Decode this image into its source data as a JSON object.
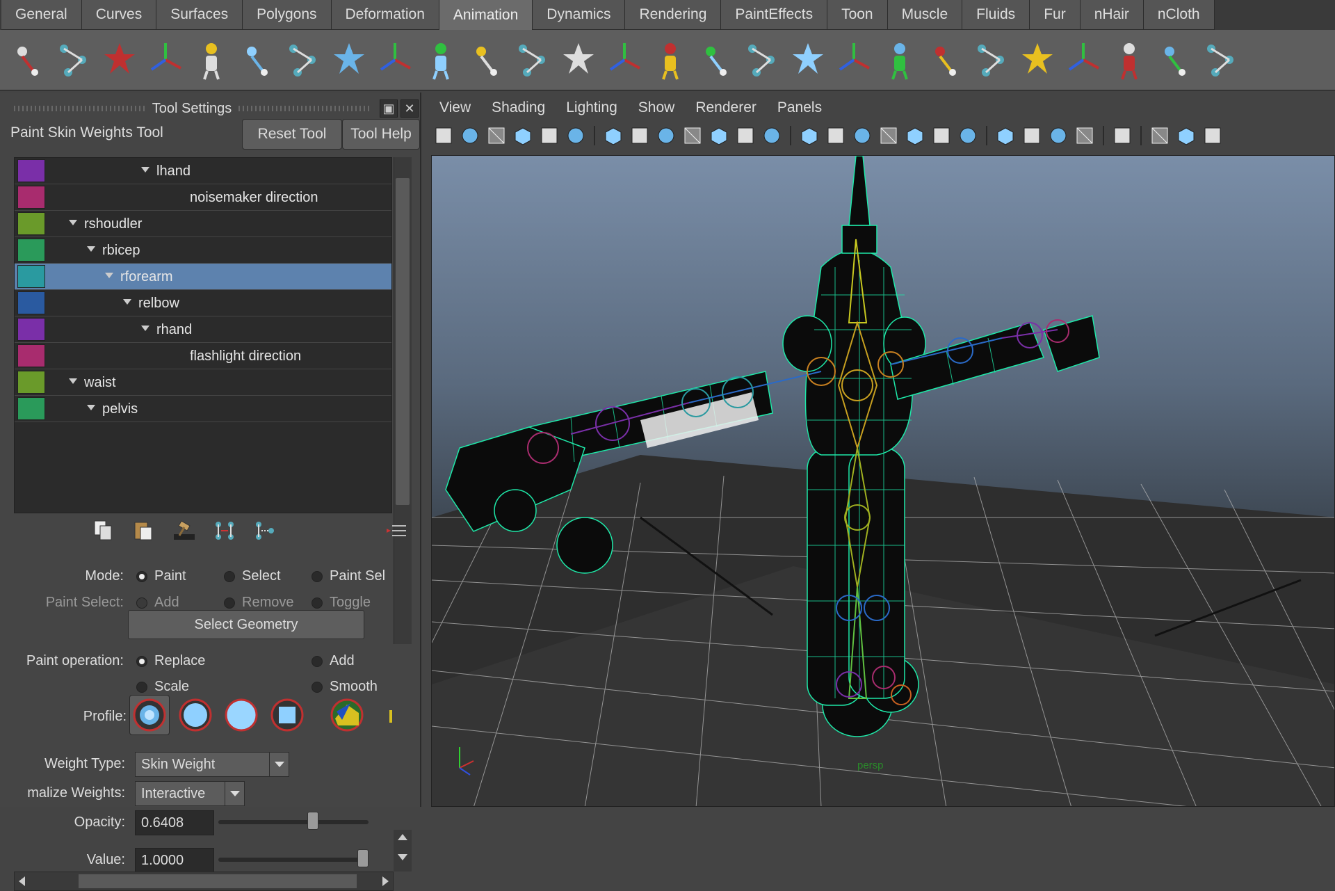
{
  "shelf": {
    "tabs": [
      "General",
      "Curves",
      "Surfaces",
      "Polygons",
      "Deformation",
      "Animation",
      "Dynamics",
      "Rendering",
      "PaintEffects",
      "Toon",
      "Muscle",
      "Fluids",
      "Fur",
      "nHair",
      "nCloth"
    ],
    "active_tab": "Animation",
    "icons": [
      "set-key-icon",
      "ik-handle-icon",
      "ik-spline-icon",
      "bind-skin-icon",
      "smooth-bind-icon",
      "character-icon",
      "joint-tool-icon",
      "insert-joint-icon",
      "mirror-joint-icon",
      "orient-joint-icon",
      "remove-joint-icon",
      "delete-history-icon",
      "connect-joint-icon",
      "disconnect-joint-icon",
      "joint-axis-icon",
      "joint-chain-icon",
      "skeleton-icon",
      "hair-head-icon",
      "hair-head-2-icon",
      "paint-weights-icon",
      "export-weights-icon",
      "paint-brush-icon",
      "cluster-icon",
      "point-constraint-icon",
      "aim-constraint-icon",
      "orient-constraint-icon",
      "parent-constraint-icon"
    ]
  },
  "tool_settings": {
    "title": "Tool Settings",
    "tool_name": "Paint Skin Weights Tool",
    "reset_label": "Reset Tool",
    "help_label": "Tool Help",
    "influences": [
      {
        "name": "lhand",
        "color": "#7a2fa8",
        "indent": 0,
        "expanded": true
      },
      {
        "name": "noisemaker direction",
        "color": "#a82c6e",
        "indent": 1,
        "expanded": false
      },
      {
        "name": "rshoudler",
        "color": "#6a9a2a",
        "indent": -4,
        "expanded": true
      },
      {
        "name": "rbicep",
        "color": "#2a9a5a",
        "indent": -3,
        "expanded": true
      },
      {
        "name": "rforearm",
        "color": "#2a9aa0",
        "indent": -2,
        "expanded": true,
        "selected": true
      },
      {
        "name": "relbow",
        "color": "#2a5aa0",
        "indent": -1,
        "expanded": true
      },
      {
        "name": "rhand",
        "color": "#7a2fa8",
        "indent": 0,
        "expanded": true
      },
      {
        "name": "flashlight direction",
        "color": "#a82c6e",
        "indent": 1,
        "expanded": false
      },
      {
        "name": "waist",
        "color": "#6a9a2a",
        "indent": -4,
        "expanded": true
      },
      {
        "name": "pelvis",
        "color": "#2a9a5a",
        "indent": -3,
        "expanded": true
      }
    ],
    "mode_label": "Mode:",
    "mode_options": [
      "Paint",
      "Select",
      "Paint Sel"
    ],
    "paint_select_label": "Paint Select:",
    "paint_select_options": [
      "Add",
      "Remove",
      "Toggle"
    ],
    "select_geometry_label": "Select Geometry",
    "paint_operation_label": "Paint operation:",
    "paint_operations": [
      "Replace",
      "Add",
      "Scale",
      "Smooth"
    ],
    "profile_label": "Profile:",
    "weight_type_label": "Weight Type:",
    "weight_type_value": "Skin Weight",
    "normalize_label": "malize Weights:",
    "normalize_value": "Interactive",
    "opacity_label": "Opacity:",
    "opacity_value": "0.6408",
    "opacity_fraction": 0.6408,
    "value_label": "Value:",
    "value_value": "1.0000",
    "value_fraction": 1.0
  },
  "viewport": {
    "menus": [
      "View",
      "Shading",
      "Lighting",
      "Show",
      "Renderer",
      "Panels"
    ],
    "camera": "persp",
    "colors": {
      "wire": "#1ee8a8",
      "accent": "#e8d820"
    }
  }
}
